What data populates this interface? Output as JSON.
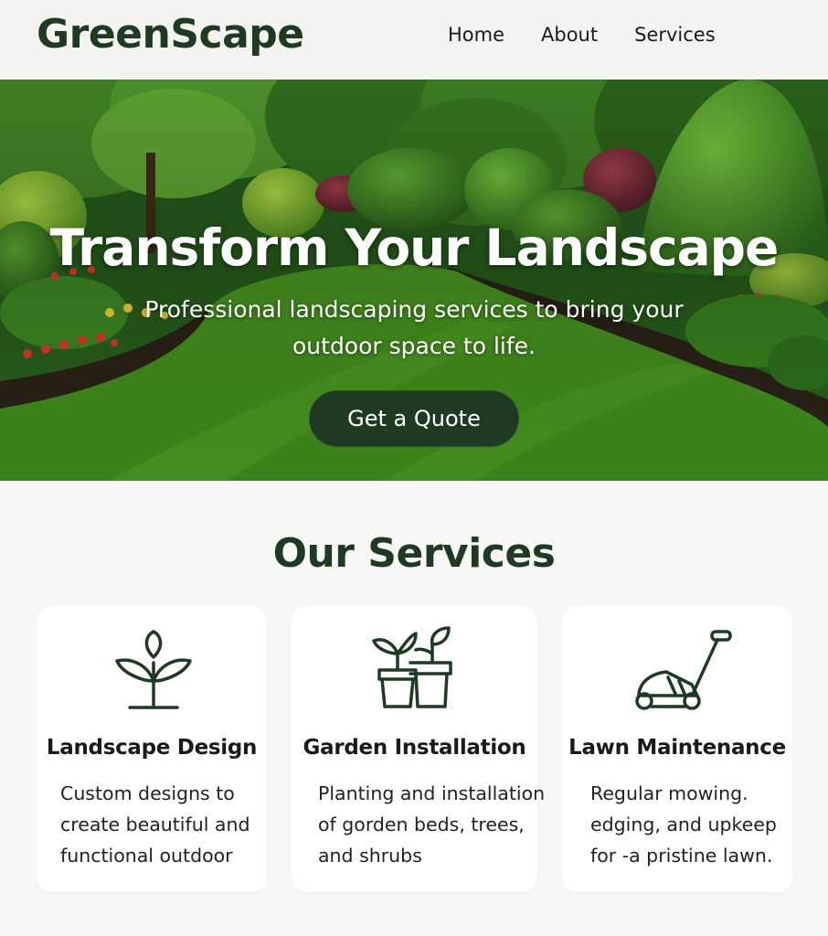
{
  "header": {
    "logo": "GreenScape",
    "nav": [
      "Home",
      "About",
      "Services"
    ]
  },
  "hero": {
    "title": "Transform Your Landscape",
    "subtitle_lines": [
      "Professional landscaping services to bring your",
      "outdoor space to life."
    ],
    "cta_label": "Get a Quote"
  },
  "services": {
    "title": "Our Services",
    "cards": [
      {
        "icon": "sprout-icon",
        "title": "Landscape Design",
        "desc_lines": [
          "Custom designs to",
          "create beautiful and",
          "functional outdoor"
        ]
      },
      {
        "icon": "potted-plants-icon",
        "title": "Garden Installation",
        "desc_lines": [
          "Planting and installation",
          "of gorden beds, trees,",
          "and shrubs"
        ]
      },
      {
        "icon": "lawn-mower-icon",
        "title": "Lawn Maintenance",
        "desc_lines": [
          "Regular mowing.",
          "edging, and upkeep",
          "for -a pristine lawn."
        ]
      }
    ]
  },
  "colors": {
    "brand_dark_green": "#1f3a23",
    "cta_background": "#1e3a22",
    "page_background": "#f7f7f6",
    "card_background": "#ffffff"
  }
}
